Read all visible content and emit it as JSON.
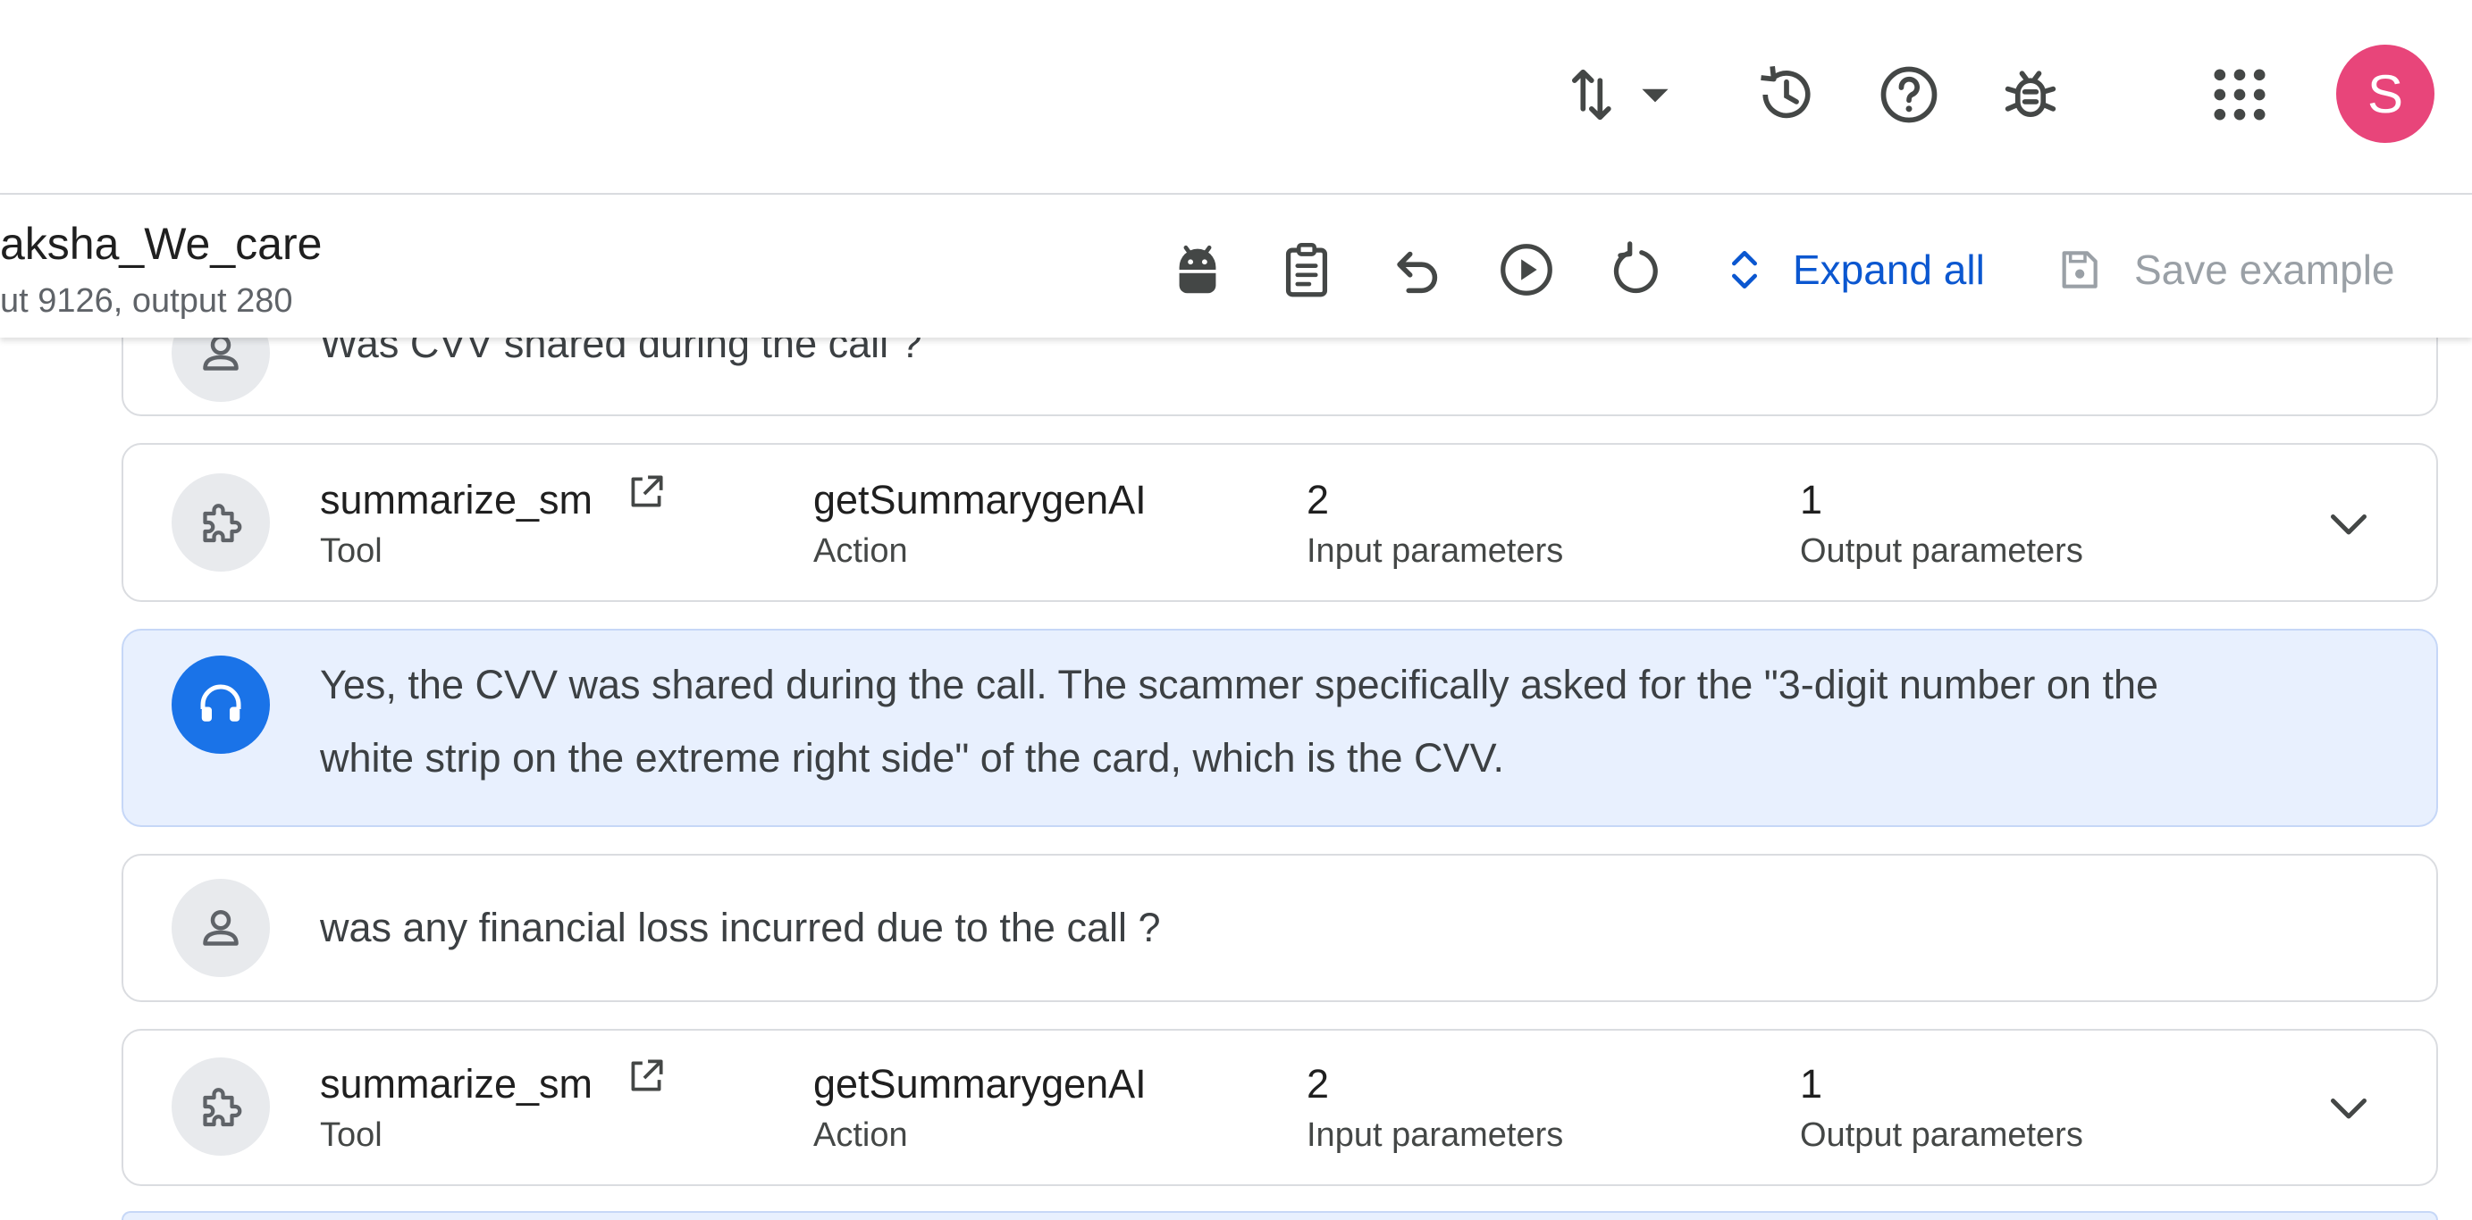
{
  "header": {
    "avatar_initial": "S",
    "agent_name": "aksha_We_care",
    "token_info": "ut 9126, output 280",
    "expand_all_label": "Expand all",
    "save_example_label": "Save example"
  },
  "conversation": {
    "partial_user_message": "Was CVV shared during the call ?",
    "tool_calls": [
      {
        "tool_name": "summarize_sm",
        "tool_label": "Tool",
        "action_name": "getSummarygenAI",
        "action_label": "Action",
        "input_count": "2",
        "input_label": "Input parameters",
        "output_count": "1",
        "output_label": "Output parameters"
      },
      {
        "tool_name": "summarize_sm",
        "tool_label": "Tool",
        "action_name": "getSummarygenAI",
        "action_label": "Action",
        "input_count": "2",
        "input_label": "Input parameters",
        "output_count": "1",
        "output_label": "Output parameters"
      }
    ],
    "agent_message_line1": "Yes, the CVV was shared during the call. The scammer specifically asked for the \"3-digit number on the",
    "agent_message_line2": "white strip on the extreme right side\" of the card, which is the CVV.",
    "user_message": "was any financial loss incurred due to the call ?"
  },
  "colors": {
    "accent": "#0b57d0",
    "avatar": "#e8457a",
    "agent_bubble": "#e8f0fe"
  }
}
